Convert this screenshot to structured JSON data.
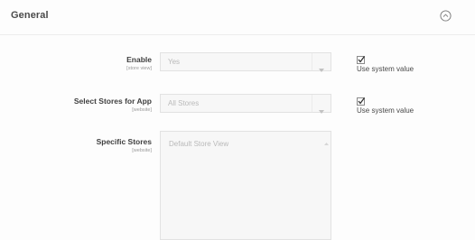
{
  "section": {
    "title": "General"
  },
  "fields": {
    "enable": {
      "label": "Enable",
      "scope": "[store view]",
      "value": "Yes",
      "use_system_value_label": "Use system value",
      "use_system_value_checked": true
    },
    "select_stores": {
      "label": "Select Stores for App",
      "scope": "[website]",
      "value": "All Stores",
      "use_system_value_label": "Use system value",
      "use_system_value_checked": true
    },
    "specific_stores": {
      "label": "Specific Stores",
      "scope": "[website]",
      "options": [
        "Default Store View"
      ]
    }
  },
  "icons": {
    "collapse": "collapse-circle-chevron-up-icon",
    "dropdown": "caret-down-icon",
    "checkbox": "checkmark-icon"
  },
  "colors": {
    "disabled_field_bg": "#f7f7f7",
    "disabled_text": "#b9b9b9",
    "label_text": "#3f3f3f",
    "border": "#e2e2e2"
  }
}
